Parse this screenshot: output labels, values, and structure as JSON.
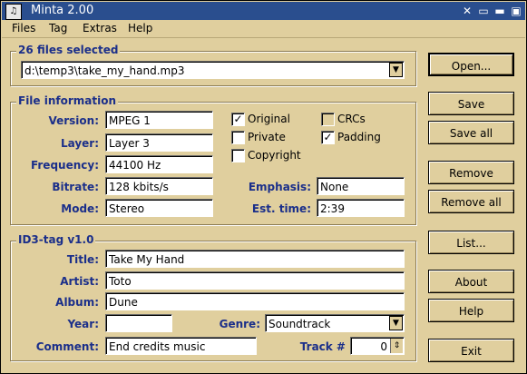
{
  "window": {
    "title": "Minta 2.00"
  },
  "menu": [
    {
      "label": "Files"
    },
    {
      "label": "Tag"
    },
    {
      "label": "Extras"
    },
    {
      "label": "Help"
    }
  ],
  "selection": {
    "group_title": "26 files selected",
    "file_value": "d:\\temp3\\take_my_hand.mp3"
  },
  "file_info": {
    "group_title": "File information",
    "version_label": "Version:",
    "version": "MPEG 1",
    "layer_label": "Layer:",
    "layer": "Layer 3",
    "frequency_label": "Frequency:",
    "frequency": "44100 Hz",
    "bitrate_label": "Bitrate:",
    "bitrate": "128 kbits/s",
    "mode_label": "Mode:",
    "mode": "Stereo",
    "emphasis_label": "Emphasis:",
    "emphasis": "None",
    "esttime_label": "Est. time:",
    "esttime": "2:39",
    "checks": {
      "original": {
        "label": "Original",
        "checked": true
      },
      "private": {
        "label": "Private",
        "checked": false
      },
      "copyright": {
        "label": "Copyright",
        "checked": false
      },
      "crcs": {
        "label": "CRCs",
        "checked": false
      },
      "padding": {
        "label": "Padding",
        "checked": true
      }
    }
  },
  "id3": {
    "group_title": "ID3-tag v1.0",
    "title_label": "Title:",
    "title": "Take My Hand",
    "artist_label": "Artist:",
    "artist": "Toto",
    "album_label": "Album:",
    "album": "Dune",
    "year_label": "Year:",
    "year": "",
    "genre_label": "Genre:",
    "genre": "Soundtrack",
    "comment_label": "Comment:",
    "comment": "End credits music",
    "track_label": "Track #",
    "track": "0"
  },
  "buttons": {
    "open": "Open...",
    "save": "Save",
    "save_all": "Save all",
    "remove": "Remove",
    "remove_all": "Remove all",
    "list": "List...",
    "about": "About",
    "help": "Help",
    "exit": "Exit"
  }
}
